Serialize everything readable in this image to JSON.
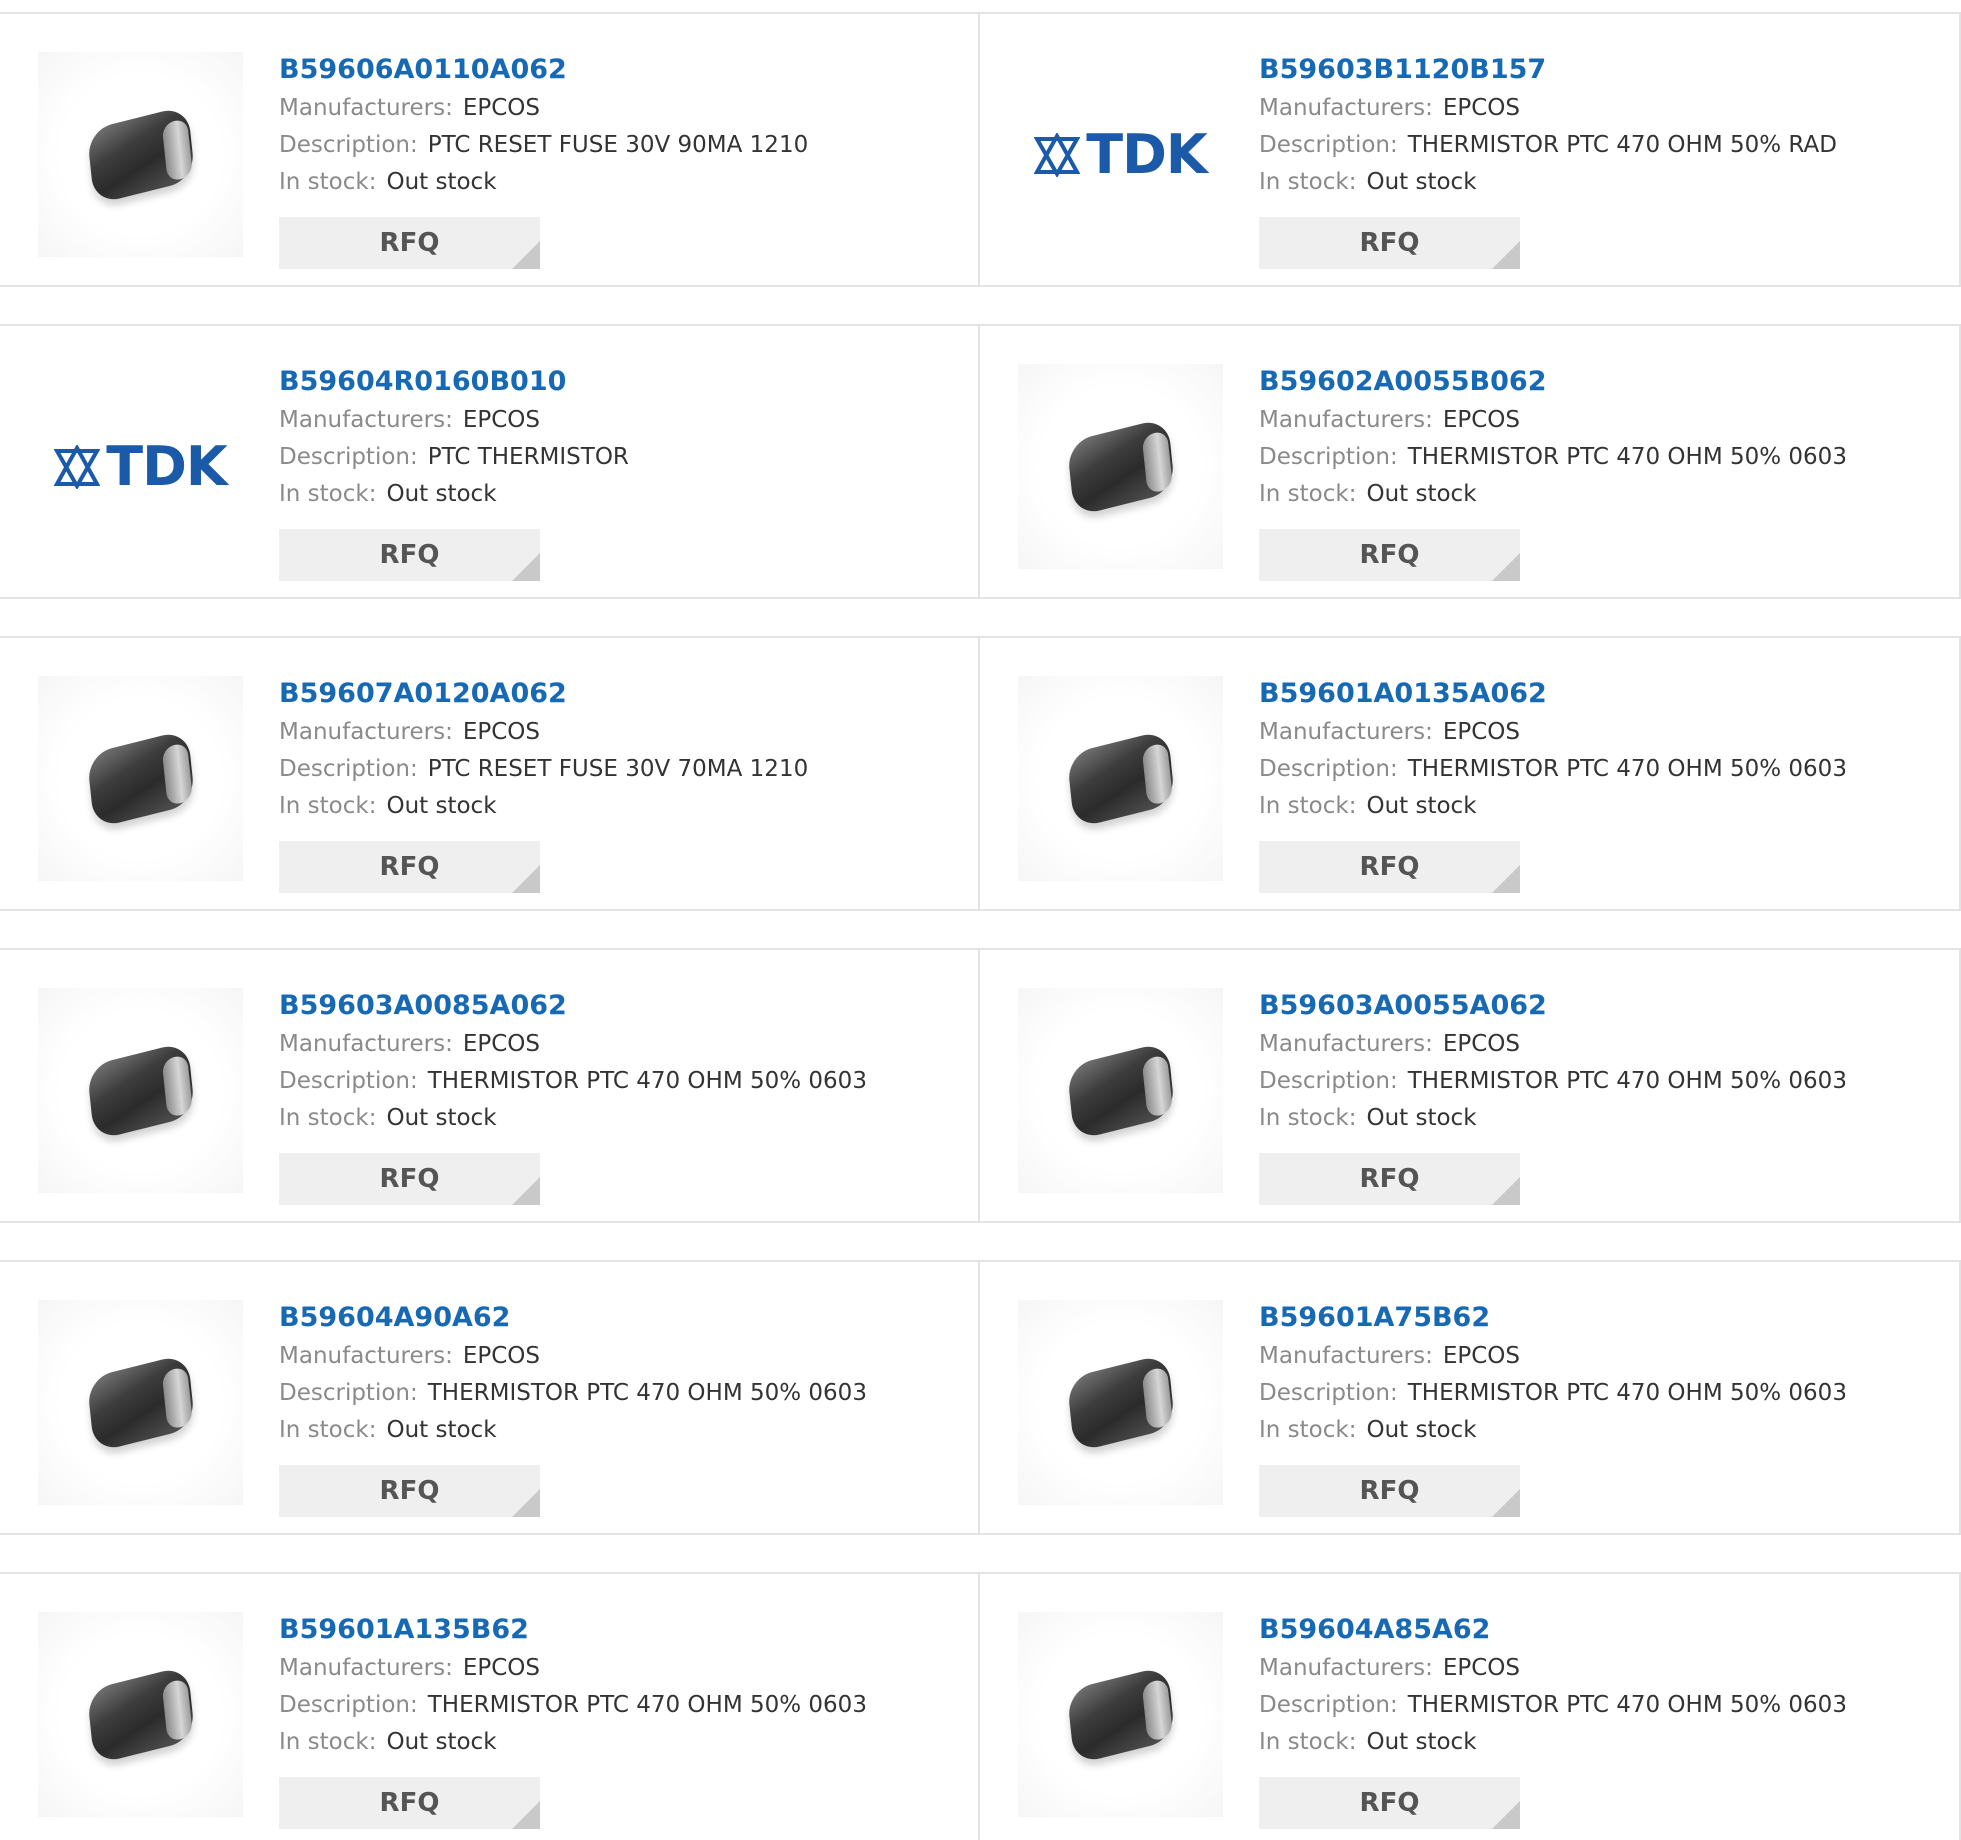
{
  "products": [
    {
      "part": "B59606A0110A062",
      "image": "chip-icon",
      "manufacturer_label": "Manufacturers:",
      "manufacturer": "EPCOS",
      "description_label": "Description:",
      "description": "PTC RESET FUSE 30V 90MA 1210",
      "stock_label": "In stock:",
      "stock": "Out stock",
      "button": "RFQ"
    },
    {
      "part": "B59603B1120B157",
      "image": "tdk-logo",
      "logo_text": "TDK",
      "manufacturer_label": "Manufacturers:",
      "manufacturer": "EPCOS",
      "description_label": "Description:",
      "description": "THERMISTOR PTC 470 OHM 50% RAD",
      "stock_label": "In stock:",
      "stock": "Out stock",
      "button": "RFQ"
    },
    {
      "part": "B59604R0160B010",
      "image": "tdk-logo",
      "logo_text": "TDK",
      "manufacturer_label": "Manufacturers:",
      "manufacturer": "EPCOS",
      "description_label": "Description:",
      "description": "PTC THERMISTOR",
      "stock_label": "In stock:",
      "stock": "Out stock",
      "button": "RFQ"
    },
    {
      "part": "B59602A0055B062",
      "image": "chip-icon",
      "manufacturer_label": "Manufacturers:",
      "manufacturer": "EPCOS",
      "description_label": "Description:",
      "description": "THERMISTOR PTC 470 OHM 50% 0603",
      "stock_label": "In stock:",
      "stock": "Out stock",
      "button": "RFQ"
    },
    {
      "part": "B59607A0120A062",
      "image": "chip-icon",
      "manufacturer_label": "Manufacturers:",
      "manufacturer": "EPCOS",
      "description_label": "Description:",
      "description": "PTC RESET FUSE 30V 70MA 1210",
      "stock_label": "In stock:",
      "stock": "Out stock",
      "button": "RFQ"
    },
    {
      "part": "B59601A0135A062",
      "image": "chip-icon",
      "manufacturer_label": "Manufacturers:",
      "manufacturer": "EPCOS",
      "description_label": "Description:",
      "description": "THERMISTOR PTC 470 OHM 50% 0603",
      "stock_label": "In stock:",
      "stock": "Out stock",
      "button": "RFQ"
    },
    {
      "part": "B59603A0085A062",
      "image": "chip-icon",
      "manufacturer_label": "Manufacturers:",
      "manufacturer": "EPCOS",
      "description_label": "Description:",
      "description": "THERMISTOR PTC 470 OHM 50% 0603",
      "stock_label": "In stock:",
      "stock": "Out stock",
      "button": "RFQ"
    },
    {
      "part": "B59603A0055A062",
      "image": "chip-icon",
      "manufacturer_label": "Manufacturers:",
      "manufacturer": "EPCOS",
      "description_label": "Description:",
      "description": "THERMISTOR PTC 470 OHM 50% 0603",
      "stock_label": "In stock:",
      "stock": "Out stock",
      "button": "RFQ"
    },
    {
      "part": "B59604A90A62",
      "image": "chip-icon",
      "manufacturer_label": "Manufacturers:",
      "manufacturer": "EPCOS",
      "description_label": "Description:",
      "description": "THERMISTOR PTC 470 OHM 50% 0603",
      "stock_label": "In stock:",
      "stock": "Out stock",
      "button": "RFQ"
    },
    {
      "part": "B59601A75B62",
      "image": "chip-icon",
      "manufacturer_label": "Manufacturers:",
      "manufacturer": "EPCOS",
      "description_label": "Description:",
      "description": "THERMISTOR PTC 470 OHM 50% 0603",
      "stock_label": "In stock:",
      "stock": "Out stock",
      "button": "RFQ"
    },
    {
      "part": "B59601A135B62",
      "image": "chip-icon",
      "manufacturer_label": "Manufacturers:",
      "manufacturer": "EPCOS",
      "description_label": "Description:",
      "description": "THERMISTOR PTC 470 OHM 50% 0603",
      "stock_label": "In stock:",
      "stock": "Out stock",
      "button": "RFQ"
    },
    {
      "part": "B59604A85A62",
      "image": "chip-icon",
      "manufacturer_label": "Manufacturers:",
      "manufacturer": "EPCOS",
      "description_label": "Description:",
      "description": "THERMISTOR PTC 470 OHM 50% 0603",
      "stock_label": "In stock:",
      "stock": "Out stock",
      "button": "RFQ"
    }
  ],
  "colors": {
    "part_link": "#1869b3",
    "label": "#8a8a8a",
    "value": "#333333",
    "button_bg": "#efefef",
    "button_text": "#555555",
    "tdk_blue": "#1a5aa8",
    "border": "#e3e3e3"
  }
}
